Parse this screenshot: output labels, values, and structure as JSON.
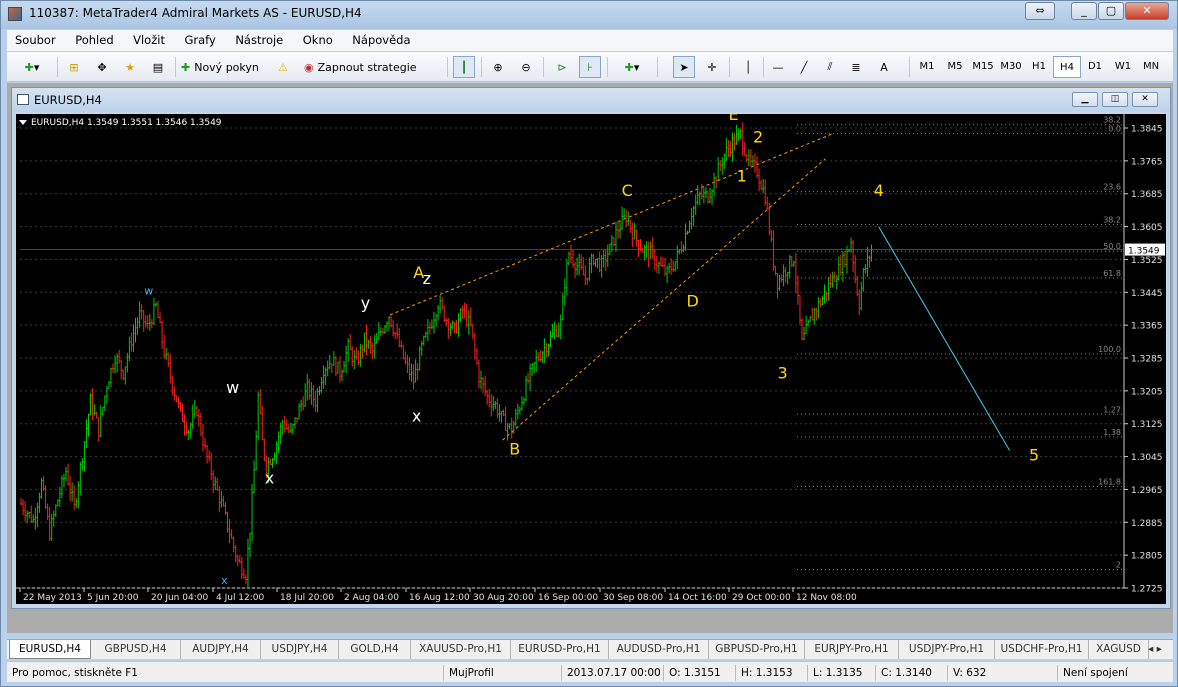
{
  "window": {
    "title": "110387: MetaTrader4 Admiral Markets AS - EURUSD,H4"
  },
  "menu": [
    "Soubor",
    "Pohled",
    "Vložit",
    "Grafy",
    "Nástroje",
    "Okno",
    "Nápověda"
  ],
  "toolbar": {
    "new_order": "Nový pokyn",
    "autotrading": "Zapnout strategie",
    "draw_text": "A",
    "timeframes": [
      "M1",
      "M5",
      "M15",
      "M30",
      "H1",
      "H4",
      "D1",
      "W1",
      "MN"
    ],
    "active_timeframe": "H4"
  },
  "chart_window": {
    "title": "EURUSD,H4"
  },
  "chart_data": {
    "type": "candlestick",
    "symbol": "EURUSD,H4",
    "header": "EURUSD,H4  1.3549 1.3551 1.3546 1.3549",
    "current_price": "1.3549",
    "colors": {
      "background": "#000000",
      "bull": "#00cc00",
      "bear": "#ff2020",
      "grid": "#3a3a3a",
      "fib": "#888888",
      "wave_label": "#ffd800",
      "wxy_label": "#ffffff",
      "cyan_line": "#40d0f0",
      "trendline": "#ff9a00"
    },
    "ylim": [
      1.2725,
      1.3845
    ],
    "y_ticks": [
      "1.3845",
      "1.3765",
      "1.3685",
      "1.3605",
      "1.3525",
      "1.3445",
      "1.3365",
      "1.3285",
      "1.3205",
      "1.3125",
      "1.3045",
      "1.2965",
      "1.2885",
      "1.2805",
      "1.2725"
    ],
    "x_ticks": [
      "22 May 2013",
      "5 Jun 20:00",
      "20 Jun 04:00",
      "4 Jul 12:00",
      "18 Jul 20:00",
      "2 Aug 04:00",
      "16 Aug 12:00",
      "30 Aug 20:00",
      "16 Sep 00:00",
      "30 Sep 08:00",
      "14 Oct 16:00",
      "29 Oct 00:00",
      "12 Nov 08:00"
    ],
    "fib_levels": [
      {
        "label": "38.2",
        "price": 1.3853
      },
      {
        "label": "0.0",
        "price": 1.3832
      },
      {
        "label": "23.6",
        "price": 1.369
      },
      {
        "label": "38.2",
        "price": 1.361
      },
      {
        "label": "50.0",
        "price": 1.3545
      },
      {
        "label": "61.8",
        "price": 1.348
      },
      {
        "label": "100.0",
        "price": 1.3295
      },
      {
        "label": "1.27",
        "price": 1.3148
      },
      {
        "label": "1.38",
        "price": 1.3093
      },
      {
        "label": "161.8",
        "price": 1.2972
      },
      {
        "label": "2",
        "price": 1.277
      }
    ],
    "price_path": [
      [
        0,
        1.293
      ],
      [
        6,
        1.289
      ],
      [
        10,
        1.298
      ],
      [
        14,
        1.286
      ],
      [
        18,
        1.294
      ],
      [
        22,
        1.301
      ],
      [
        26,
        1.292
      ],
      [
        30,
        1.305
      ],
      [
        34,
        1.318
      ],
      [
        38,
        1.311
      ],
      [
        42,
        1.322
      ],
      [
        46,
        1.329
      ],
      [
        50,
        1.325
      ],
      [
        54,
        1.333
      ],
      [
        58,
        1.339
      ],
      [
        62,
        1.336
      ],
      [
        66,
        1.341
      ],
      [
        70,
        1.33
      ],
      [
        74,
        1.322
      ],
      [
        78,
        1.315
      ],
      [
        82,
        1.311
      ],
      [
        86,
        1.316
      ],
      [
        90,
        1.306
      ],
      [
        94,
        1.299
      ],
      [
        98,
        1.293
      ],
      [
        102,
        1.286
      ],
      [
        106,
        1.279
      ],
      [
        110,
        1.276
      ],
      [
        112,
        1.287
      ],
      [
        114,
        1.301
      ],
      [
        116,
        1.319
      ],
      [
        118,
        1.308
      ],
      [
        120,
        1.302
      ],
      [
        124,
        1.306
      ],
      [
        128,
        1.313
      ],
      [
        132,
        1.31
      ],
      [
        136,
        1.316
      ],
      [
        140,
        1.321
      ],
      [
        144,
        1.318
      ],
      [
        148,
        1.326
      ],
      [
        152,
        1.328
      ],
      [
        156,
        1.325
      ],
      [
        160,
        1.331
      ],
      [
        164,
        1.327
      ],
      [
        168,
        1.333
      ],
      [
        172,
        1.33
      ],
      [
        176,
        1.335
      ],
      [
        180,
        1.339
      ],
      [
        184,
        1.333
      ],
      [
        188,
        1.327
      ],
      [
        192,
        1.323
      ],
      [
        196,
        1.331
      ],
      [
        200,
        1.336
      ],
      [
        204,
        1.342
      ],
      [
        208,
        1.338
      ],
      [
        212,
        1.335
      ],
      [
        216,
        1.34
      ],
      [
        220,
        1.336
      ],
      [
        224,
        1.324
      ],
      [
        228,
        1.319
      ],
      [
        232,
        1.317
      ],
      [
        236,
        1.313
      ],
      [
        240,
        1.311
      ],
      [
        244,
        1.317
      ],
      [
        248,
        1.323
      ],
      [
        252,
        1.328
      ],
      [
        256,
        1.331
      ],
      [
        260,
        1.334
      ],
      [
        264,
        1.337
      ],
      [
        266,
        1.347
      ],
      [
        268,
        1.354
      ],
      [
        272,
        1.351
      ],
      [
        276,
        1.348
      ],
      [
        280,
        1.353
      ],
      [
        284,
        1.351
      ],
      [
        288,
        1.355
      ],
      [
        292,
        1.36
      ],
      [
        296,
        1.363
      ],
      [
        300,
        1.358
      ],
      [
        304,
        1.355
      ],
      [
        308,
        1.354
      ],
      [
        312,
        1.351
      ],
      [
        316,
        1.349
      ],
      [
        320,
        1.352
      ],
      [
        324,
        1.357
      ],
      [
        328,
        1.364
      ],
      [
        332,
        1.368
      ],
      [
        336,
        1.368
      ],
      [
        340,
        1.373
      ],
      [
        344,
        1.378
      ],
      [
        348,
        1.381
      ],
      [
        352,
        1.383
      ],
      [
        356,
        1.376
      ],
      [
        360,
        1.374
      ],
      [
        364,
        1.368
      ],
      [
        366,
        1.36
      ],
      [
        368,
        1.352
      ],
      [
        370,
        1.347
      ],
      [
        374,
        1.35
      ],
      [
        378,
        1.353
      ],
      [
        380,
        1.342
      ],
      [
        382,
        1.332
      ],
      [
        384,
        1.335
      ],
      [
        388,
        1.34
      ],
      [
        392,
        1.343
      ],
      [
        396,
        1.347
      ],
      [
        400,
        1.35
      ],
      [
        404,
        1.354
      ],
      [
        406,
        1.357
      ],
      [
        408,
        1.348
      ],
      [
        410,
        1.342
      ],
      [
        412,
        1.349
      ],
      [
        416,
        1.3549
      ]
    ],
    "wave_labels": [
      {
        "text": "A",
        "bar": 195,
        "price": 1.348,
        "color": "#ffd800"
      },
      {
        "text": "z",
        "bar": 199,
        "price": 1.3465,
        "color": "#ffffff"
      },
      {
        "text": "y",
        "bar": 169,
        "price": 1.3405,
        "color": "#ffffff"
      },
      {
        "text": "w",
        "bar": 63,
        "price": 1.344,
        "color": "#40b0ff",
        "small": true
      },
      {
        "text": "w",
        "bar": 104,
        "price": 1.32,
        "color": "#ffffff"
      },
      {
        "text": "x",
        "bar": 194,
        "price": 1.313,
        "color": "#ffffff"
      },
      {
        "text": "x",
        "bar": 122,
        "price": 1.298,
        "color": "#ffffff"
      },
      {
        "text": "x",
        "bar": 100,
        "price": 1.2735,
        "color": "#40b0ff",
        "small": true
      },
      {
        "text": "B",
        "bar": 242,
        "price": 1.305,
        "color": "#ffd800"
      },
      {
        "text": "C",
        "bar": 297,
        "price": 1.368,
        "color": "#ffd800"
      },
      {
        "text": "D",
        "bar": 329,
        "price": 1.341,
        "color": "#ffd800"
      },
      {
        "text": "E",
        "bar": 349,
        "price": 1.3865,
        "color": "#ffd800"
      },
      {
        "text": "1",
        "bar": 353,
        "price": 1.3715,
        "color": "#ffd800"
      },
      {
        "text": "2",
        "bar": 361,
        "price": 1.381,
        "color": "#ffd800"
      },
      {
        "text": "3",
        "bar": 373,
        "price": 1.3235,
        "color": "#ffd800"
      },
      {
        "text": "4",
        "bar": 420,
        "price": 1.368,
        "color": "#ffd800"
      },
      {
        "text": "5",
        "bar": 496,
        "price": 1.3035,
        "color": "#ffd800"
      }
    ],
    "trendlines": [
      {
        "from": [
          181,
          1.339
        ],
        "to": [
          397,
          1.383
        ],
        "color": "#ff9a00",
        "dash": true
      },
      {
        "from": [
          236,
          1.3085
        ],
        "to": [
          394,
          1.377
        ],
        "color": "#ff9a00",
        "dash": true
      },
      {
        "from": [
          420,
          1.3605
        ],
        "to": [
          484,
          1.306
        ],
        "color": "#40d0f0",
        "dash": false
      }
    ]
  },
  "tabs": [
    "EURUSD,H4",
    "GBPUSD,H4",
    "AUDJPY,H4",
    "USDJPY,H4",
    "GOLD,H4",
    "XAUUSD-Pro,H1",
    "EURUSD-Pro,H1",
    "AUDUSD-Pro,H1",
    "GBPUSD-Pro,H1",
    "EURJPY-Pro,H1",
    "USDJPY-Pro,H1",
    "USDCHF-Pro,H1",
    "XAGUSD"
  ],
  "status": {
    "help": "Pro pomoc, stiskněte F1",
    "profile": "MujProfil",
    "datetime": "2013.07.17 00:00",
    "open": "O: 1.3151",
    "high": "H: 1.3153",
    "low": "L: 1.3135",
    "close": "C: 1.3140",
    "volume": "V: 632",
    "connection": "Není spojení"
  }
}
